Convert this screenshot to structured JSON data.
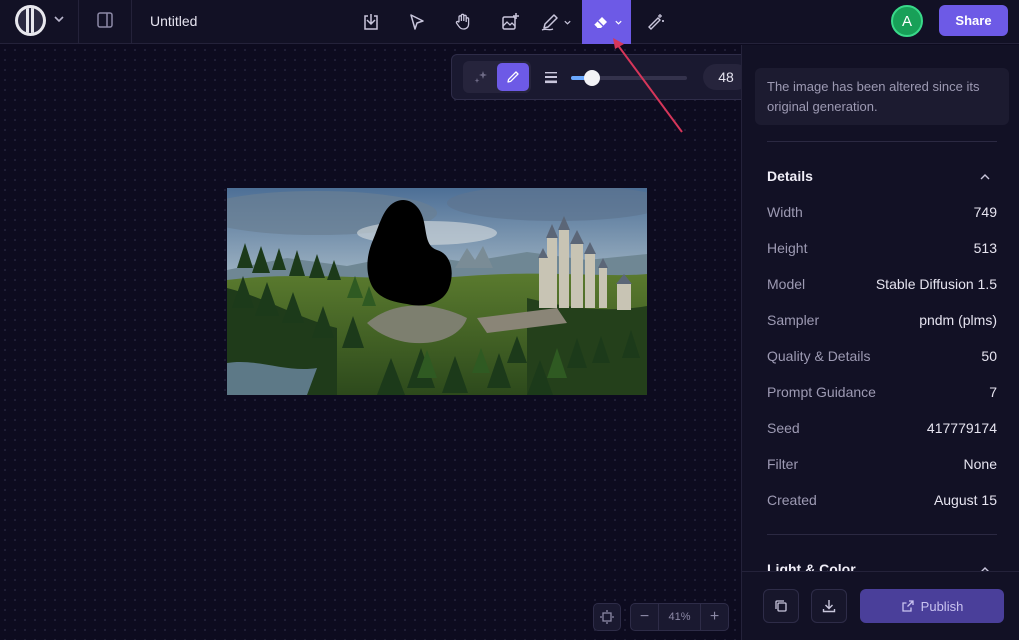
{
  "app": {
    "doc_title": "Untitled",
    "share_label": "Share",
    "avatar_initial": "A"
  },
  "toolbar": {
    "tools": [
      "import-icon",
      "select-icon",
      "hand-icon",
      "image-add-icon",
      "pen-icon",
      "eraser-icon",
      "magic-wand-icon"
    ],
    "active_tool": "eraser"
  },
  "brush": {
    "size": "48",
    "slider_fraction": 0.18
  },
  "canvas": {
    "zoom": "41%"
  },
  "panel": {
    "notice": "The image has been altered since its original generation.",
    "details_title": "Details",
    "details": [
      {
        "key": "Width",
        "value": "749"
      },
      {
        "key": "Height",
        "value": "513"
      },
      {
        "key": "Model",
        "value": "Stable Diffusion 1.5"
      },
      {
        "key": "Sampler",
        "value": "pndm (plms)"
      },
      {
        "key": "Quality & Details",
        "value": "50"
      },
      {
        "key": "Prompt Guidance",
        "value": "7"
      },
      {
        "key": "Seed",
        "value": "417779174"
      },
      {
        "key": "Filter",
        "value": "None"
      },
      {
        "key": "Created",
        "value": "August 15"
      }
    ],
    "light_color_title": "Light & Color",
    "publish_label": "Publish"
  },
  "colors": {
    "accent": "#6d5ae6",
    "background": "#0d0b1f",
    "annotation_arrow": "#d6365a"
  }
}
